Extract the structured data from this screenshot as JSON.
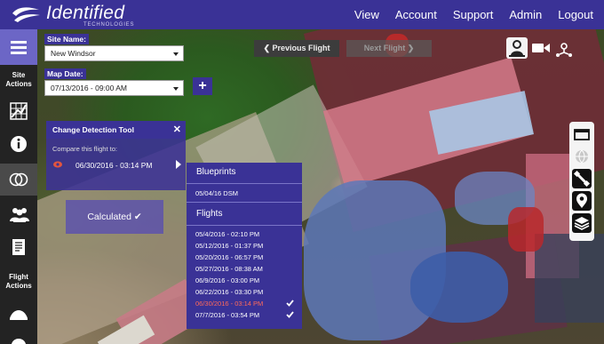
{
  "brand": {
    "name": "Identified",
    "tagline": "TECHNOLOGIES",
    "color": "#3a3296"
  },
  "nav": {
    "items": [
      "View",
      "Account",
      "Support",
      "Admin",
      "Logout"
    ]
  },
  "sidebar": {
    "site_actions_label": "Site Actions",
    "flight_actions_label": "Flight Actions",
    "active_color": "#6c66c6",
    "icons": [
      "menu-icon",
      "grid-map-icon",
      "info-icon",
      "compare-circles-icon",
      "users-icon",
      "report-icon",
      "mound-icon"
    ]
  },
  "site": {
    "label": "Site Name:",
    "value": "New Windsor"
  },
  "map_date": {
    "label": "Map Date:",
    "value": "07/13/2016 - 09:00 AM"
  },
  "pager": {
    "previous": "❮  Previous Flight",
    "next": "Next Flight  ❯"
  },
  "change_detection": {
    "title": "Change Detection Tool",
    "compare_label": "Compare this flight to:",
    "selected_date": "06/30/2016 - 03:14 PM",
    "calculated_label": "Calculated ✔"
  },
  "dropdown": {
    "blueprints_heading": "Blueprints",
    "blueprints": [
      "05/04/16 DSM"
    ],
    "flights_heading": "Flights",
    "flights": [
      {
        "label": "05/4/2016 - 02:10 PM",
        "selected": false,
        "checked": false
      },
      {
        "label": "05/12/2016 - 01:37 PM",
        "selected": false,
        "checked": false
      },
      {
        "label": "05/20/2016 - 06:57 PM",
        "selected": false,
        "checked": false
      },
      {
        "label": "05/27/2016 - 08:38 AM",
        "selected": false,
        "checked": false
      },
      {
        "label": "06/9/2016 - 03:00 PM",
        "selected": false,
        "checked": false
      },
      {
        "label": "06/22/2016 - 03:30 PM",
        "selected": false,
        "checked": false
      },
      {
        "label": "06/30/2016 - 03:14 PM",
        "selected": true,
        "checked": true
      },
      {
        "label": "07/7/2016 - 03:54 PM",
        "selected": false,
        "checked": true
      }
    ],
    "selected_color": "#ff6a5a"
  },
  "view_tools": [
    "person-pin-icon",
    "video-camera-icon",
    "drone-icon"
  ],
  "map_tools": [
    "layers-panel-icon",
    "globe-icon",
    "satellite-icon",
    "map-pin-icon",
    "stack-icon"
  ]
}
